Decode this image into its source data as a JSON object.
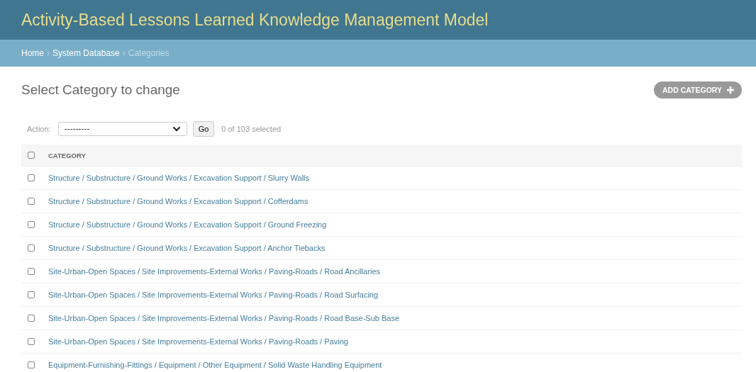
{
  "header": {
    "title": "Activity-Based Lessons Learned Knowledge Management Model"
  },
  "breadcrumbs": {
    "separator": "›",
    "items": [
      {
        "label": "Home",
        "current": false
      },
      {
        "label": "System Database",
        "current": false
      },
      {
        "label": "Categories",
        "current": true
      }
    ]
  },
  "page_title": "Select Category to change",
  "add_button": "ADD CATEGORY",
  "actions": {
    "label": "Action:",
    "value": "---------",
    "go": "Go",
    "counter": "0 of 103 selected"
  },
  "table": {
    "columns": [
      {
        "label": "CATEGORY"
      }
    ],
    "select_all_checked": false,
    "rows": [
      {
        "category": "Structure / Substructure / Ground Works / Excavation Support / Slurry Walls",
        "checked": false
      },
      {
        "category": "Structure / Substructure / Ground Works / Excavation Support / Cofferdams",
        "checked": false
      },
      {
        "category": "Structure / Substructure / Ground Works / Excavation Support / Ground Freezing",
        "checked": false
      },
      {
        "category": "Structure / Substructure / Ground Works / Excavation Support / Anchor Tiebacks",
        "checked": false
      },
      {
        "category": "Site-Urban-Open Spaces / Site Improvements-External Works / Paving-Roads / Road Ancillaries",
        "checked": false
      },
      {
        "category": "Site-Urban-Open Spaces / Site Improvements-External Works / Paving-Roads / Road Surfacing",
        "checked": false
      },
      {
        "category": "Site-Urban-Open Spaces / Site Improvements-External Works / Paving-Roads / Road Base-Sub Base",
        "checked": false
      },
      {
        "category": "Site-Urban-Open Spaces / Site Improvements-External Works / Paving-Roads / Paving",
        "checked": false
      },
      {
        "category": "Equipment-Furnishing-Fittings / Equipment / Other Equipment / Solid Waste Handling Equipment",
        "checked": false
      }
    ]
  }
}
